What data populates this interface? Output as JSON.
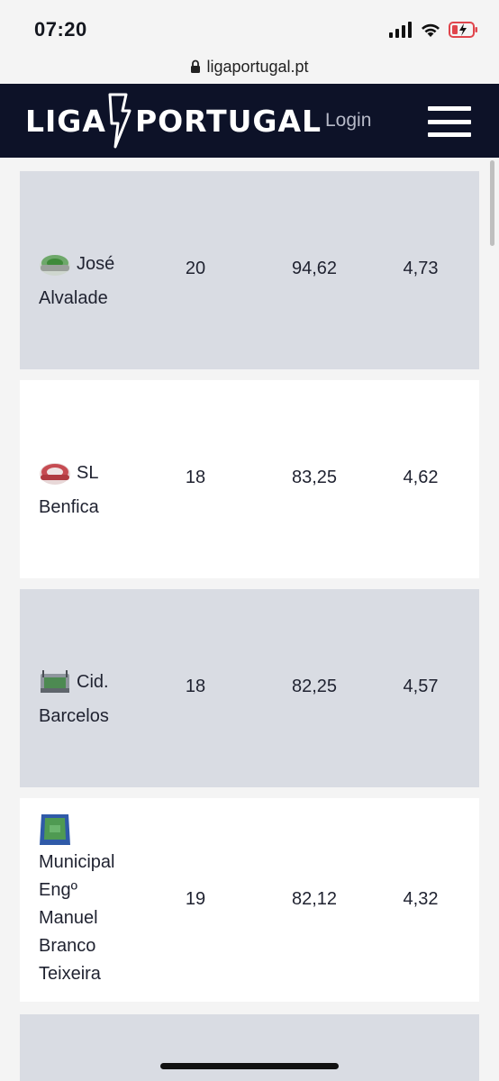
{
  "status_bar": {
    "time": "07:20",
    "icons": [
      "signal-icon",
      "wifi-icon",
      "battery-icon"
    ]
  },
  "browser": {
    "url": "ligaportugal.pt",
    "lock_icon": "lock-icon"
  },
  "header": {
    "logo_text_left": "LIGA",
    "logo_text_right": "PORTUGAL",
    "login_label": "Login",
    "menu_icon": "hamburger-menu-icon",
    "background_color": "#0d1228"
  },
  "table": {
    "rows": [
      {
        "stadium_line1": "José",
        "stadium_rest": "Alvalade",
        "col1": "20",
        "col2": "94,62",
        "col3": "4,73",
        "thumb": "stadium-green-icon"
      },
      {
        "stadium_line1": "SL",
        "stadium_rest": "Benfica",
        "col1": "18",
        "col2": "83,25",
        "col3": "4,62",
        "thumb": "stadium-red-icon"
      },
      {
        "stadium_line1": "Cid.",
        "stadium_rest": "Barcelos",
        "col1": "18",
        "col2": "82,25",
        "col3": "4,57",
        "thumb": "stadium-grey-icon"
      },
      {
        "stadium_line1": "",
        "stadium_rest": "Municipal Engº Manuel Branco Teixeira",
        "col1": "19",
        "col2": "82,12",
        "col3": "4,32",
        "thumb": "stadium-blue-icon"
      }
    ]
  }
}
